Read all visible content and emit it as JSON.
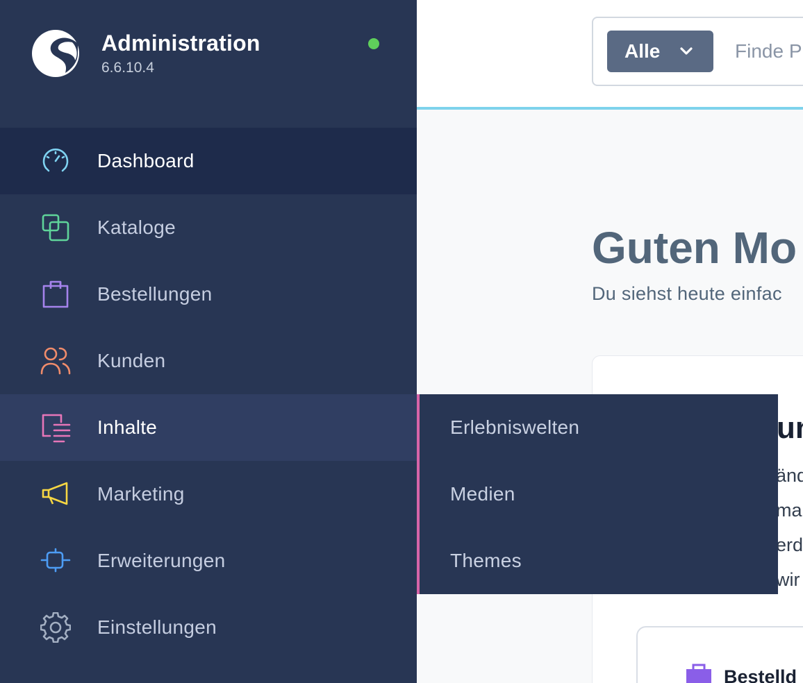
{
  "brand": {
    "title": "Administration",
    "version": "6.6.10.4",
    "status_color": "#5fcf5b"
  },
  "sidebar": {
    "items": [
      {
        "label": "Dashboard",
        "icon": "dashboard-gauge-icon",
        "color": "#7fd3f2",
        "state": "active"
      },
      {
        "label": "Kataloge",
        "icon": "catalog-squares-icon",
        "color": "#5fd49a",
        "state": "normal"
      },
      {
        "label": "Bestellungen",
        "icon": "shopping-bag-icon",
        "color": "#a583ec",
        "state": "normal"
      },
      {
        "label": "Kunden",
        "icon": "users-icon",
        "color": "#f08c6b",
        "state": "normal"
      },
      {
        "label": "Inhalte",
        "icon": "content-list-icon",
        "color": "#e676b8",
        "state": "hover"
      },
      {
        "label": "Marketing",
        "icon": "megaphone-icon",
        "color": "#f7d743",
        "state": "normal"
      },
      {
        "label": "Erweiterungen",
        "icon": "plug-icon",
        "color": "#4d9cf4",
        "state": "normal"
      },
      {
        "label": "Einstellungen",
        "icon": "gear-icon",
        "color": "#a3afc2",
        "state": "normal"
      }
    ]
  },
  "flyout": {
    "accent_color": "#d664a8",
    "items": [
      {
        "label": "Erlebniswelten"
      },
      {
        "label": "Medien"
      },
      {
        "label": "Themes"
      }
    ]
  },
  "search": {
    "filter_label": "Alle",
    "placeholder": "Finde P"
  },
  "main": {
    "greeting": "Guten Mo",
    "subtitle": "Du siehst heute einfac",
    "card": {
      "title_fragment": "un",
      "line_fragments": [
        "änd",
        "ma",
        "erde",
        "wir"
      ],
      "inner_card_label": "Bestelld"
    }
  }
}
